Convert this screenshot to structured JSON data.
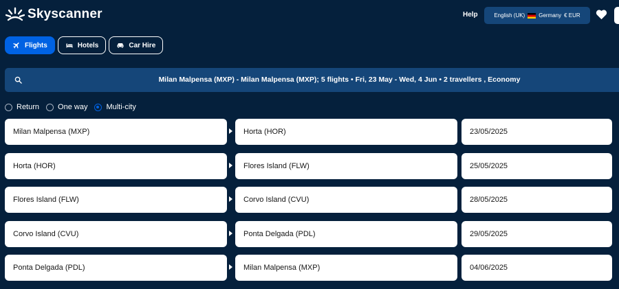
{
  "brand": {
    "name": "Skyscanner"
  },
  "header": {
    "help": "Help",
    "language": "English (UK)",
    "country": "Germany",
    "currency": "€ EUR"
  },
  "tabs": [
    {
      "label": "Flights",
      "active": true
    },
    {
      "label": "Hotels",
      "active": false
    },
    {
      "label": "Car Hire",
      "active": false
    }
  ],
  "summary": {
    "text": "Milan Malpensa (MXP) - Milan Malpensa (MXP); 5 flights  •  Fri, 23 May - Wed, 4 Jun  •  2 travellers , Economy"
  },
  "trip_type": {
    "options": [
      "Return",
      "One way",
      "Multi-city"
    ],
    "selected": "Multi-city"
  },
  "legs": [
    {
      "from": "Milan Malpensa (MXP)",
      "to": "Horta (HOR)",
      "date": "23/05/2025"
    },
    {
      "from": "Horta (HOR)",
      "to": "Flores Island (FLW)",
      "date": "25/05/2025"
    },
    {
      "from": "Flores Island (FLW)",
      "to": "Corvo Island (CVU)",
      "date": "28/05/2025"
    },
    {
      "from": "Corvo Island (CVU)",
      "to": "Ponta Delgada (PDL)",
      "date": "29/05/2025"
    },
    {
      "from": "Ponta Delgada (PDL)",
      "to": "Milan Malpensa (MXP)",
      "date": "04/06/2025"
    }
  ],
  "colors": {
    "background": "#05203c",
    "accent": "#0062e3",
    "panel": "#154679"
  }
}
